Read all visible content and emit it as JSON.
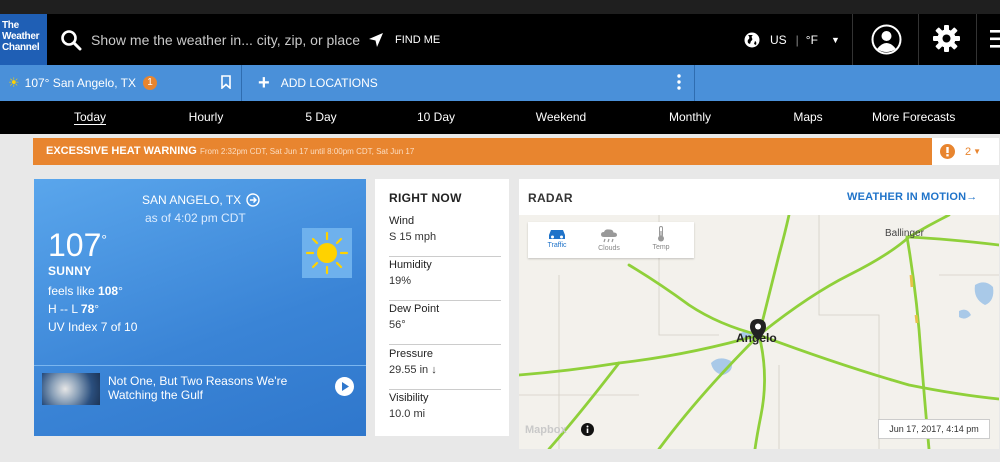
{
  "header": {
    "logo_lines": [
      "The",
      "Weather",
      "Channel"
    ],
    "search_placeholder": "Show me the weather in... city, zip, or place",
    "find_me": "FIND ME",
    "country": "US",
    "unit": "°F"
  },
  "location_bar": {
    "current_location": "107° San Angelo, TX",
    "badge": "1",
    "add_locations": "ADD LOCATIONS"
  },
  "nav": {
    "items": [
      "Today",
      "Hourly",
      "5 Day",
      "10 Day",
      "Weekend",
      "Monthly",
      "Maps",
      "More Forecasts"
    ],
    "active": "Today"
  },
  "warning": {
    "title": "EXCESSIVE HEAT WARNING",
    "detail": "From 2:32pm CDT, Sat Jun 17 until 8:00pm CDT, Sat Jun 17",
    "count": "2",
    "color": "#e8852f"
  },
  "current": {
    "location": "SAN ANGELO, TX",
    "as_of": "as of 4:02 pm CDT",
    "temp": "107",
    "deg": "°",
    "phrase": "SUNNY",
    "feels_prefix": "feels like ",
    "feels_value": "108",
    "feels_deg": "°",
    "hilo_prefix": "H -- L ",
    "low": "78",
    "low_deg": "°",
    "uv": "UV Index 7 of 10",
    "video_title": "Not One, But Two Reasons We're Watching the Gulf",
    "icon": "sun-icon"
  },
  "right_now": {
    "title": "RIGHT NOW",
    "rows": [
      {
        "label": "Wind",
        "value": "S 15 mph"
      },
      {
        "label": "Humidity",
        "value": "19%"
      },
      {
        "label": "Dew Point",
        "value": "56°"
      },
      {
        "label": "Pressure",
        "value": "29.55 in ↓"
      },
      {
        "label": "Visibility",
        "value": "10.0 mi"
      }
    ]
  },
  "radar": {
    "title": "RADAR",
    "link": "WEATHER IN MOTION→",
    "layers": [
      "Traffic",
      "Clouds",
      "Temp"
    ],
    "active_layer": "Traffic",
    "city_label": "Angelo",
    "town_label": "Ballinger",
    "attribution": "Mapbox",
    "timestamp": "Jun 17, 2017, 4:14 pm"
  }
}
